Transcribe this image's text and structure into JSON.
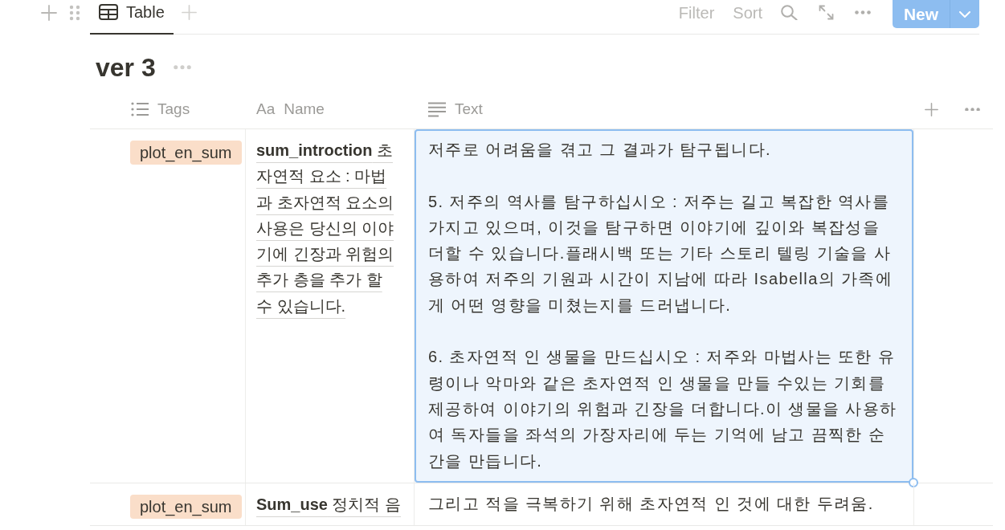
{
  "toolbar": {
    "views": [
      {
        "label": "Table",
        "selected": true
      }
    ],
    "actions": [
      "Filter",
      "Sort"
    ],
    "new_button": "New"
  },
  "database": {
    "title": "ver 3"
  },
  "table": {
    "columns": [
      {
        "kind": "multi_select",
        "label": "Tags"
      },
      {
        "kind": "title",
        "icon_text": "Aa",
        "label": "Name"
      },
      {
        "kind": "text",
        "label": "Text"
      }
    ],
    "rows": [
      {
        "tags": [
          {
            "label": "plot_en_sum",
            "color": "#fadec9"
          }
        ],
        "name": "**sum_introction** 초자연적 요소 : 마법과 초자연적 요소의 사용은 당신의 이야기에 긴장과 위험의 추가 층을 추가 할 수 있습니다.",
        "text": {
          "editing": true,
          "paragraphs": [
            "저주로 어려움을 겪고 그 결과가 탐구됩니다.",
            "5. 저주의 역사를 탐구하십시오 : 저주는 길고 복잡한 역사를 가지고 있으며, 이것을 탐구하면 이야기에 깊이와 복잡성을 더할 수 있습니다.플래시백 또는 기타 스토리 텔링 기술을 사용하여 저주의 기원과 시간이 지남에 따라 Isabella의 가족에게 어떤 영향을 미쳤는지를 드러냅니다.",
            "6. 초자연적 인 생물을 만드십시오 : 저주와 마법사는 또한 유령이나 악마와 같은 초자연적 인 생물을 만들 수있는 기회를 제공하여 이야기의 위험과 긴장을 더합니다.이 생물을 사용하여 독자들을 좌석의 가장자리에 두는 기억에 남고 끔찍한 순간을 만듭니다."
          ]
        }
      },
      {
        "tags": [
          {
            "label": "plot_en_sum",
            "color": "#fadec9"
          }
        ],
        "name": "**Sum_use** 정치적 음",
        "text": {
          "editing": false,
          "paragraphs": [
            "그리고 적을 극복하기 위해 초자연적 인 것에 대한 두려움."
          ]
        }
      }
    ]
  }
}
